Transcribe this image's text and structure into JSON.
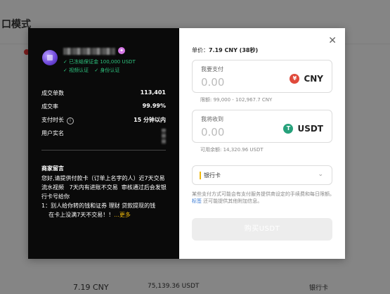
{
  "background": {
    "title": "口模式",
    "bottom_row": {
      "price": "7.19 CNY",
      "amount": "75,139.36 USDT",
      "method": "银行卡"
    }
  },
  "merchant": {
    "verify_line1": "✓ 已冻结保证金 100,000 USDT",
    "verify_email": "✓ 视频认证",
    "verify_id": "✓ 身份认证",
    "stats": [
      {
        "label": "成交单数",
        "value": "113,401"
      },
      {
        "label": "成交率",
        "value": "99.99%"
      },
      {
        "label": "支付时长",
        "value": "15 分钟以内"
      },
      {
        "label": "用户实名",
        "value": ""
      }
    ],
    "message_title": "商家留言",
    "message_body": "您好,请提供付款卡（订单上名字的人）近7天交易流水视频   7天内有进账不交易  审核通过后会发银行卡号给你\n1：别人给你转的钱和证券 理财 贷款提现的钱\n    在卡上没满7天不交易！！",
    "more_label": "...更多"
  },
  "order": {
    "unit_label": "单价：",
    "unit_price": "7.19 CNY (38秒)",
    "pay": {
      "label": "我要支付",
      "placeholder": "0.00",
      "currency": "CNY",
      "currency_icon": "¥",
      "limit": "限额: 99,000 - 102,967.7 CNY"
    },
    "receive": {
      "label": "我将收到",
      "placeholder": "0.00",
      "currency": "USDT",
      "currency_icon": "T",
      "available": "可用余额: 14,320.96 USDT"
    },
    "payment_method": "银行卡",
    "note_prefix": "某些支付方式可能会有支付服务提供商设定的手续费和每日限额。",
    "note_link": "标签",
    "note_suffix": " 还可能提供其他附加信息。",
    "buy_label": "购买USDT"
  },
  "colors": {
    "accent": "#f0b90b",
    "success": "#2ec27e",
    "cny": "#e04a3b",
    "usdt": "#26a17b"
  }
}
